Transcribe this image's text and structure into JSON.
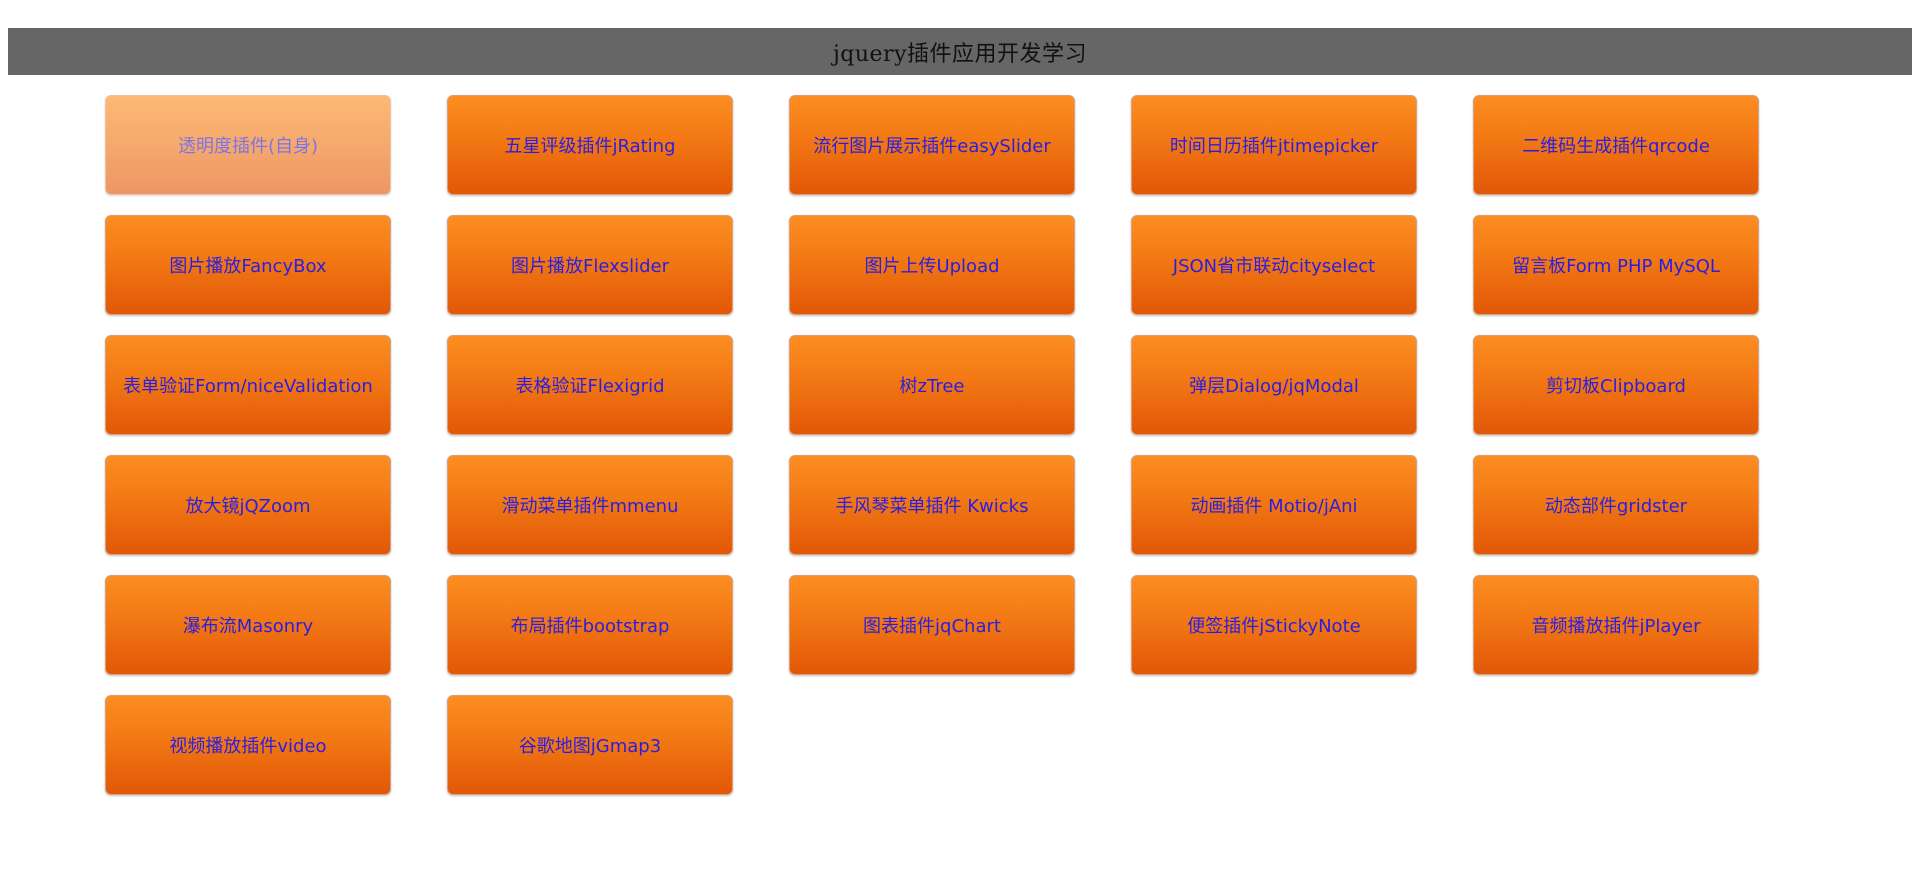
{
  "header": {
    "title": "jquery插件应用开发学习",
    "background": "#666666"
  },
  "colors": {
    "button_top": "#fc8e22",
    "button_bottom": "#e25708",
    "label": "#2a1ee0"
  },
  "plugins": [
    {
      "label": "透明度插件(自身)",
      "faded": true
    },
    {
      "label": "五星评级插件jRating"
    },
    {
      "label": "流行图片展示插件easySlider"
    },
    {
      "label": "时间日历插件jtimepicker"
    },
    {
      "label": "二维码生成插件qrcode"
    },
    {
      "label": "图片播放FancyBox"
    },
    {
      "label": "图片播放Flexslider"
    },
    {
      "label": "图片上传Upload"
    },
    {
      "label": "JSON省市联动cityselect"
    },
    {
      "label": "留言板Form PHP MySQL"
    },
    {
      "label": "表单验证Form/niceValidation"
    },
    {
      "label": "表格验证Flexigrid"
    },
    {
      "label": "树zTree"
    },
    {
      "label": "弹层Dialog/jqModal"
    },
    {
      "label": "剪切板Clipboard"
    },
    {
      "label": "放大镜jQZoom"
    },
    {
      "label": "滑动菜单插件mmenu"
    },
    {
      "label": "手风琴菜单插件 Kwicks"
    },
    {
      "label": "动画插件 Motio/jAni"
    },
    {
      "label": "动态部件gridster"
    },
    {
      "label": "瀑布流Masonry"
    },
    {
      "label": "布局插件bootstrap"
    },
    {
      "label": "图表插件jqChart"
    },
    {
      "label": "便签插件jStickyNote"
    },
    {
      "label": "音频播放插件jPlayer"
    },
    {
      "label": "视频播放插件video"
    },
    {
      "label": "谷歌地图jGmap3"
    }
  ]
}
